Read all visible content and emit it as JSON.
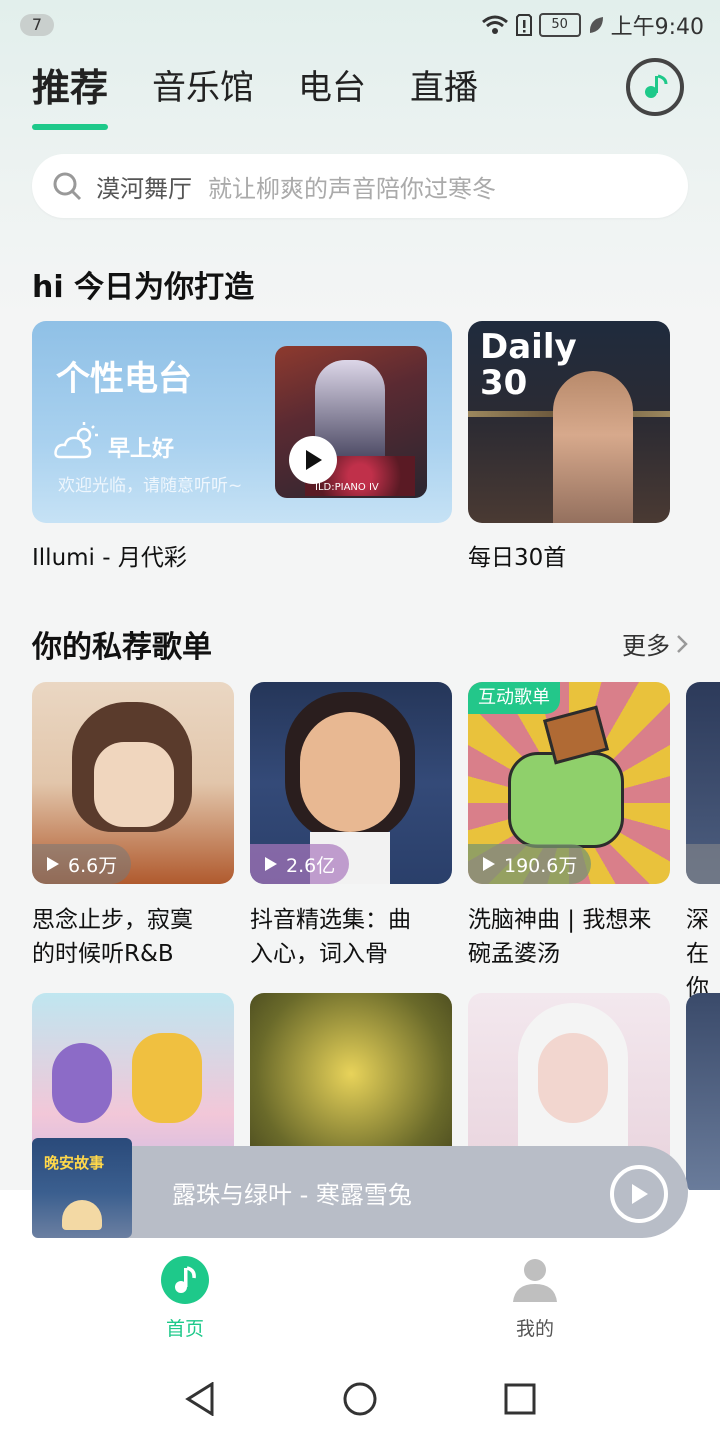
{
  "status_bar": {
    "notification_count": "7",
    "battery": "50",
    "time": "上午9:40"
  },
  "tabs": [
    {
      "label": "推荐",
      "active": true
    },
    {
      "label": "音乐馆",
      "active": false
    },
    {
      "label": "电台",
      "active": false
    },
    {
      "label": "直播",
      "active": false
    }
  ],
  "search": {
    "hint": "漠河舞厅",
    "placeholder": "就让柳爽的声音陪你过寒冬"
  },
  "today": {
    "title": "hi 今日为你打造",
    "radio": {
      "title": "个性电台",
      "greeting": "早上好",
      "welcome": "欢迎光临，请随意听听~",
      "caption": "Illumi - 月代彩",
      "album_text": "ILD:PIANO IV"
    },
    "daily": {
      "label_line1": "Daily",
      "label_line2": "30",
      "caption": "每日30首"
    }
  },
  "playlists": {
    "title": "你的私荐歌单",
    "more": "更多",
    "items": [
      {
        "plays": "6.6万",
        "title_line1": "思念止步，寂寞",
        "title_line2": "的时候听R&B"
      },
      {
        "plays": "2.6亿",
        "title_line1": "抖音精选集：曲",
        "title_line2": "入心，词入骨"
      },
      {
        "plays": "190.6万",
        "tag": "互动歌单",
        "title_line1": "洗脑神曲 | 我想来",
        "title_line2": "碗孟婆汤"
      },
      {
        "title_line1": "深在",
        "title_line2": "你又"
      }
    ]
  },
  "mini_player": {
    "title": "露珠与绿叶 - 寒露雪兔",
    "cover_text": "晚安故事"
  },
  "bottom_nav": [
    {
      "label": "首页",
      "active": true
    },
    {
      "label": "我的",
      "active": false
    }
  ],
  "colors": {
    "accent": "#1ec98a",
    "player_bg": "#b8bdc7"
  }
}
